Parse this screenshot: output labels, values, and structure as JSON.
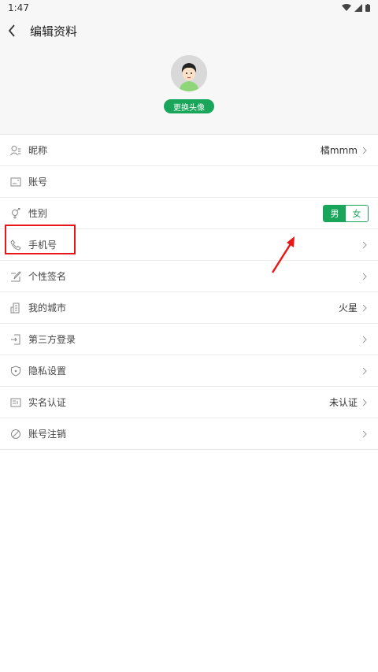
{
  "status": {
    "time": "1:47"
  },
  "header": {
    "title": "编辑资料"
  },
  "profile": {
    "change_avatar_label": "更换头像"
  },
  "rows": [
    {
      "label": "昵称",
      "value": "橘mmm",
      "icon": "user-icon"
    },
    {
      "label": "账号",
      "value": "",
      "icon": "id-card-icon"
    },
    {
      "label": "性别",
      "icon": "gender-icon",
      "options": [
        "男",
        "女"
      ],
      "selected": "男"
    },
    {
      "label": "手机号",
      "value": "",
      "icon": "phone-icon"
    },
    {
      "label": "个性签名",
      "value": "",
      "icon": "edit-icon"
    },
    {
      "label": "我的城市",
      "value": "火星",
      "icon": "building-icon"
    },
    {
      "label": "第三方登录",
      "value": "",
      "icon": "login-icon"
    },
    {
      "label": "隐私设置",
      "value": "",
      "icon": "shield-icon"
    },
    {
      "label": "实名认证",
      "value": "未认证",
      "icon": "id-badge-icon"
    },
    {
      "label": "账号注销",
      "value": "",
      "icon": "ban-icon"
    }
  ],
  "colors": {
    "accent": "#1aa65a",
    "highlight": "#e81818"
  }
}
